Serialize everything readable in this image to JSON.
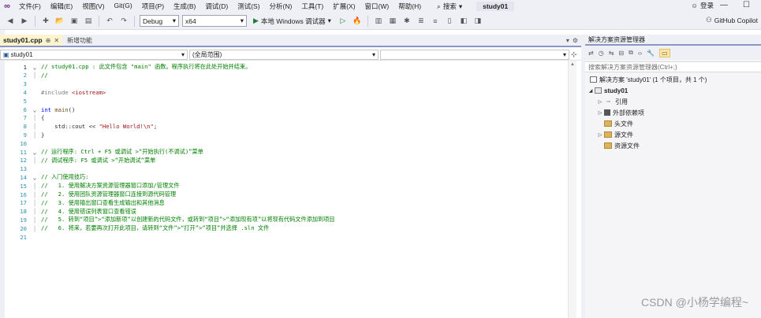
{
  "menubar": {
    "items": [
      "文件(F)",
      "编辑(E)",
      "视图(V)",
      "Git(G)",
      "项目(P)",
      "生成(B)",
      "调试(D)",
      "测试(S)",
      "分析(N)",
      "工具(T)",
      "扩展(X)",
      "窗口(W)",
      "帮助(H)"
    ],
    "search_label": "搜索",
    "title": "study01",
    "signin": "登录"
  },
  "toolbar": {
    "config": "Debug",
    "platform": "x64",
    "run_label": "本地 Windows 调试器",
    "copilot": "GitHub Copilot"
  },
  "tabs": {
    "active": "study01.cpp",
    "inactive": "新增功能"
  },
  "navbar": {
    "project": "study01",
    "scope": "(全局范围)",
    "member": ""
  },
  "code": [
    {
      "n": "1",
      "fold": "v",
      "parts": [
        {
          "c": "cm",
          "t": "// study01.cpp : 此文件包含 \"main\" 函数。程序执行将在此处开始并结束。"
        }
      ]
    },
    {
      "n": "2",
      "fold": "|",
      "parts": [
        {
          "c": "cm",
          "t": "//"
        }
      ]
    },
    {
      "n": "3",
      "fold": "",
      "parts": []
    },
    {
      "n": "4",
      "fold": "",
      "parts": [
        {
          "c": "pp",
          "t": "#include "
        },
        {
          "c": "inc",
          "t": "<iostream>"
        }
      ]
    },
    {
      "n": "5",
      "fold": "",
      "parts": []
    },
    {
      "n": "6",
      "fold": "v",
      "parts": [
        {
          "c": "kw",
          "t": "int "
        },
        {
          "c": "fn",
          "t": "main"
        },
        {
          "c": "ns",
          "t": "()"
        }
      ]
    },
    {
      "n": "7",
      "fold": "|",
      "parts": [
        {
          "c": "ns",
          "t": "{"
        }
      ]
    },
    {
      "n": "8",
      "fold": "|",
      "parts": [
        {
          "c": "ns",
          "t": "    std::cout << "
        },
        {
          "c": "str",
          "t": "\"Hello World!\\n\""
        },
        {
          "c": "ns",
          "t": ";"
        }
      ]
    },
    {
      "n": "9",
      "fold": "|",
      "parts": [
        {
          "c": "ns",
          "t": "}"
        }
      ]
    },
    {
      "n": "10",
      "fold": "",
      "parts": []
    },
    {
      "n": "11",
      "fold": "v",
      "parts": [
        {
          "c": "cm",
          "t": "// 运行程序: Ctrl + F5 或调试 >“开始执行(不调试)”菜单"
        }
      ]
    },
    {
      "n": "12",
      "fold": "|",
      "parts": [
        {
          "c": "cm",
          "t": "// 调试程序: F5 或调试 >“开始调试”菜单"
        }
      ]
    },
    {
      "n": "13",
      "fold": "",
      "parts": []
    },
    {
      "n": "14",
      "fold": "v",
      "parts": [
        {
          "c": "cm",
          "t": "// 入门使用技巧:"
        }
      ]
    },
    {
      "n": "15",
      "fold": "|",
      "parts": [
        {
          "c": "cm",
          "t": "//   1. 使用解决方案资源管理器窗口添加/管理文件"
        }
      ]
    },
    {
      "n": "16",
      "fold": "|",
      "parts": [
        {
          "c": "cm",
          "t": "//   2. 使用团队资源管理器窗口连接到源代码管理"
        }
      ]
    },
    {
      "n": "17",
      "fold": "|",
      "parts": [
        {
          "c": "cm",
          "t": "//   3. 使用输出窗口查看生成输出和其他消息"
        }
      ]
    },
    {
      "n": "18",
      "fold": "|",
      "parts": [
        {
          "c": "cm",
          "t": "//   4. 使用错误列表窗口查看错误"
        }
      ]
    },
    {
      "n": "19",
      "fold": "|",
      "parts": [
        {
          "c": "cm",
          "t": "//   5. 转到“项目”>“添加新项”以创建新的代码文件，或转到“项目”>“添加现有项”以将现有代码文件添加到项目"
        }
      ]
    },
    {
      "n": "20",
      "fold": "|",
      "parts": [
        {
          "c": "cm",
          "t": "//   6. 将来，若要再次打开此项目，请转到“文件”>“打开”>“项目”并选择 .sln 文件"
        }
      ]
    },
    {
      "n": "21",
      "fold": "",
      "parts": []
    }
  ],
  "solution_explorer": {
    "title": "解决方案资源管理器",
    "search_placeholder": "搜索解决方案资源管理器(Ctrl+;)",
    "solution": "解决方案 'study01' (1 个项目，共 1 个)",
    "project": "study01",
    "nodes": [
      {
        "label": "引用",
        "icon": "reference-icon",
        "expandable": true
      },
      {
        "label": "外部依赖项",
        "icon": "external-dependencies-icon",
        "expandable": true
      },
      {
        "label": "头文件",
        "icon": "folder-filter-icon",
        "expandable": false
      },
      {
        "label": "源文件",
        "icon": "folder-filter-icon",
        "expandable": true
      },
      {
        "label": "资源文件",
        "icon": "folder-filter-icon",
        "expandable": false
      }
    ]
  },
  "watermark": "CSDN @小杨学编程~"
}
